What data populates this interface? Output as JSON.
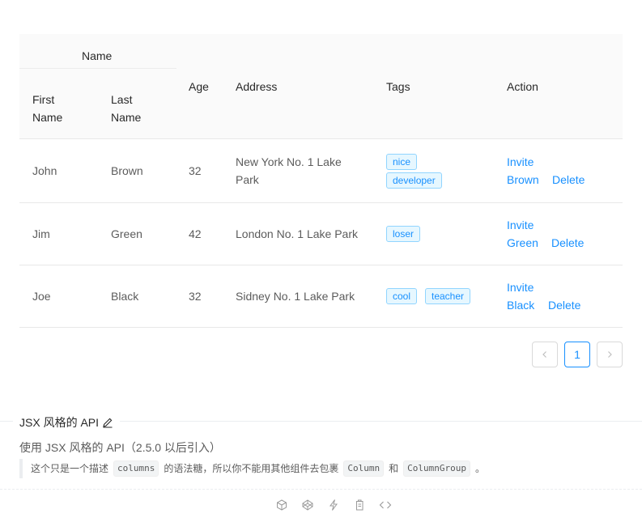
{
  "table": {
    "header": {
      "group": "Name",
      "first": [
        "First",
        "Name"
      ],
      "last": [
        "Last",
        "Name"
      ],
      "age": "Age",
      "address": "Address",
      "tags": "Tags",
      "action": "Action"
    },
    "rows": [
      {
        "first": "John",
        "last": "Brown",
        "age": "32",
        "address": [
          "New York No. 1 Lake",
          "Park"
        ],
        "tags": [
          "nice",
          "developer"
        ],
        "invite": "Invite",
        "invite_name": "Brown",
        "delete": "Delete"
      },
      {
        "first": "Jim",
        "last": "Green",
        "age": "42",
        "address": [
          "London No. 1 Lake Park"
        ],
        "tags": [
          "loser"
        ],
        "invite": "Invite",
        "invite_name": "Green",
        "delete": "Delete"
      },
      {
        "first": "Joe",
        "last": "Black",
        "age": "32",
        "address": [
          "Sidney No. 1 Lake Park"
        ],
        "tags": [
          "cool",
          "teacher"
        ],
        "invite": "Invite",
        "invite_name": "Black",
        "delete": "Delete"
      }
    ]
  },
  "pagination": {
    "current": "1",
    "prev_icon": "chevron-left-icon",
    "next_icon": "chevron-right-icon"
  },
  "demo_meta": {
    "title": "JSX 风格的 API",
    "edit_icon": "edit-icon",
    "description": "使用 JSX 风格的 API（2.5.0 以后引入）",
    "note": {
      "part1": "这个只是一个描述",
      "code1": "columns",
      "part2": "的语法糖，所以你不能用其他组件去包裹",
      "code2": "Column",
      "part3": "和",
      "code3": "ColumnGroup",
      "part4": "。"
    }
  },
  "demo_actions": [
    "codesandbox-icon",
    "codepen-icon",
    "riddle-icon",
    "copy-icon",
    "code-expand-icon"
  ],
  "colors": {
    "primary": "#1890ff",
    "tag_bg": "#e6f7ff",
    "tag_border": "#91d5ff",
    "header_bg": "#fafafa"
  }
}
